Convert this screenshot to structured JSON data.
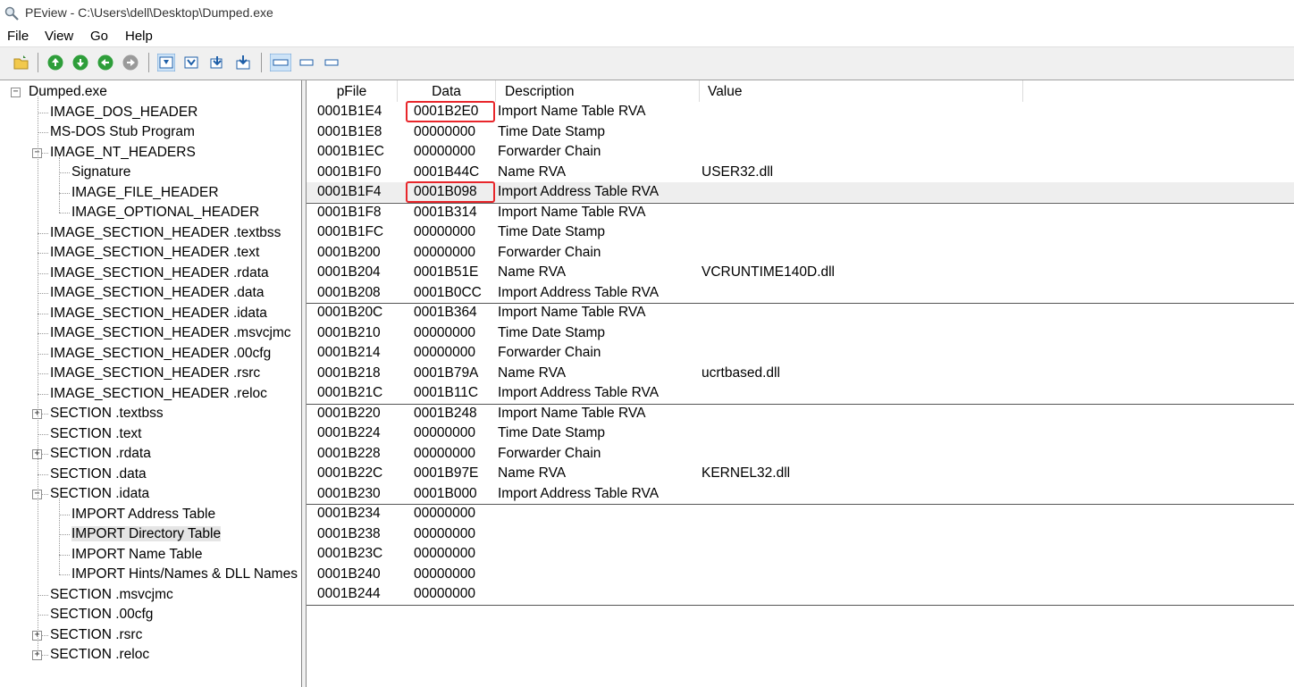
{
  "window": {
    "title": "PEview - C:\\Users\\dell\\Desktop\\Dumped.exe"
  },
  "menu": [
    "File",
    "View",
    "Go",
    "Help"
  ],
  "toolbar": [
    {
      "icon": "open-folder-icon"
    },
    {
      "icon": "back-icon"
    },
    {
      "icon": "forward-icon"
    },
    {
      "icon": "previous-icon"
    },
    {
      "icon": "next-icon"
    },
    {
      "icon": "view-byte-icon"
    },
    {
      "icon": "view-word-icon"
    },
    {
      "icon": "view-dword-icon"
    },
    {
      "icon": "view-address-icon"
    },
    {
      "icon": "save-icon"
    },
    {
      "icon": "wide-view-icon"
    },
    {
      "icon": "medium-view-icon"
    },
    {
      "icon": "narrow-view-icon"
    }
  ],
  "tree": [
    {
      "label": "Dumped.exe",
      "level": 0,
      "expander": "minus"
    },
    {
      "label": "IMAGE_DOS_HEADER",
      "level": 1
    },
    {
      "label": "MS-DOS Stub Program",
      "level": 1
    },
    {
      "label": "IMAGE_NT_HEADERS",
      "level": 1,
      "expander": "minus"
    },
    {
      "label": "Signature",
      "level": 2
    },
    {
      "label": "IMAGE_FILE_HEADER",
      "level": 2
    },
    {
      "label": "IMAGE_OPTIONAL_HEADER",
      "level": 2
    },
    {
      "label": "IMAGE_SECTION_HEADER .textbss",
      "level": 1
    },
    {
      "label": "IMAGE_SECTION_HEADER .text",
      "level": 1
    },
    {
      "label": "IMAGE_SECTION_HEADER .rdata",
      "level": 1
    },
    {
      "label": "IMAGE_SECTION_HEADER .data",
      "level": 1
    },
    {
      "label": "IMAGE_SECTION_HEADER .idata",
      "level": 1
    },
    {
      "label": "IMAGE_SECTION_HEADER .msvcjmc",
      "level": 1
    },
    {
      "label": "IMAGE_SECTION_HEADER .00cfg",
      "level": 1
    },
    {
      "label": "IMAGE_SECTION_HEADER .rsrc",
      "level": 1
    },
    {
      "label": "IMAGE_SECTION_HEADER .reloc",
      "level": 1
    },
    {
      "label": "SECTION .textbss",
      "level": 1,
      "expander": "plus"
    },
    {
      "label": "SECTION .text",
      "level": 1
    },
    {
      "label": "SECTION .rdata",
      "level": 1,
      "expander": "plus"
    },
    {
      "label": "SECTION .data",
      "level": 1
    },
    {
      "label": "SECTION .idata",
      "level": 1,
      "expander": "minus"
    },
    {
      "label": "IMPORT Address Table",
      "level": 2
    },
    {
      "label": "IMPORT Directory Table",
      "level": 2,
      "selected": true
    },
    {
      "label": "IMPORT Name Table",
      "level": 2
    },
    {
      "label": "IMPORT Hints/Names & DLL Names",
      "level": 2
    },
    {
      "label": "SECTION .msvcjmc",
      "level": 1
    },
    {
      "label": "SECTION .00cfg",
      "level": 1
    },
    {
      "label": "SECTION .rsrc",
      "level": 1,
      "expander": "plus"
    },
    {
      "label": "SECTION .reloc",
      "level": 1,
      "expander": "plus"
    }
  ],
  "columns": [
    "pFile",
    "Data",
    "Description",
    "Value"
  ],
  "rows": [
    {
      "pFile": "0001B1E4",
      "data": "0001B2E0",
      "desc": "Import Name Table RVA",
      "value": "",
      "boxed": true
    },
    {
      "pFile": "0001B1E8",
      "data": "00000000",
      "desc": "Time Date Stamp",
      "value": ""
    },
    {
      "pFile": "0001B1EC",
      "data": "00000000",
      "desc": "Forwarder Chain",
      "value": ""
    },
    {
      "pFile": "0001B1F0",
      "data": "0001B44C",
      "desc": "Name RVA",
      "value": "USER32.dll"
    },
    {
      "pFile": "0001B1F4",
      "data": "0001B098",
      "desc": "Import Address Table RVA",
      "value": "",
      "boxed": true,
      "highlight": true,
      "groupEnd": true
    },
    {
      "pFile": "0001B1F8",
      "data": "0001B314",
      "desc": "Import Name Table RVA",
      "value": ""
    },
    {
      "pFile": "0001B1FC",
      "data": "00000000",
      "desc": "Time Date Stamp",
      "value": ""
    },
    {
      "pFile": "0001B200",
      "data": "00000000",
      "desc": "Forwarder Chain",
      "value": ""
    },
    {
      "pFile": "0001B204",
      "data": "0001B51E",
      "desc": "Name RVA",
      "value": "VCRUNTIME140D.dll"
    },
    {
      "pFile": "0001B208",
      "data": "0001B0CC",
      "desc": "Import Address Table RVA",
      "value": "",
      "groupEnd": true
    },
    {
      "pFile": "0001B20C",
      "data": "0001B364",
      "desc": "Import Name Table RVA",
      "value": ""
    },
    {
      "pFile": "0001B210",
      "data": "00000000",
      "desc": "Time Date Stamp",
      "value": ""
    },
    {
      "pFile": "0001B214",
      "data": "00000000",
      "desc": "Forwarder Chain",
      "value": ""
    },
    {
      "pFile": "0001B218",
      "data": "0001B79A",
      "desc": "Name RVA",
      "value": "ucrtbased.dll"
    },
    {
      "pFile": "0001B21C",
      "data": "0001B11C",
      "desc": "Import Address Table RVA",
      "value": "",
      "groupEnd": true
    },
    {
      "pFile": "0001B220",
      "data": "0001B248",
      "desc": "Import Name Table RVA",
      "value": ""
    },
    {
      "pFile": "0001B224",
      "data": "00000000",
      "desc": "Time Date Stamp",
      "value": ""
    },
    {
      "pFile": "0001B228",
      "data": "00000000",
      "desc": "Forwarder Chain",
      "value": ""
    },
    {
      "pFile": "0001B22C",
      "data": "0001B97E",
      "desc": "Name RVA",
      "value": "KERNEL32.dll"
    },
    {
      "pFile": "0001B230",
      "data": "0001B000",
      "desc": "Import Address Table RVA",
      "value": "",
      "groupEnd": true
    },
    {
      "pFile": "0001B234",
      "data": "00000000",
      "desc": "",
      "value": ""
    },
    {
      "pFile": "0001B238",
      "data": "00000000",
      "desc": "",
      "value": ""
    },
    {
      "pFile": "0001B23C",
      "data": "00000000",
      "desc": "",
      "value": ""
    },
    {
      "pFile": "0001B240",
      "data": "00000000",
      "desc": "",
      "value": ""
    },
    {
      "pFile": "0001B244",
      "data": "00000000",
      "desc": "",
      "value": "",
      "groupEnd": true
    }
  ],
  "colors": {
    "highlight_box": "#e8262b",
    "selected_row_bg": "#eeeeee"
  }
}
